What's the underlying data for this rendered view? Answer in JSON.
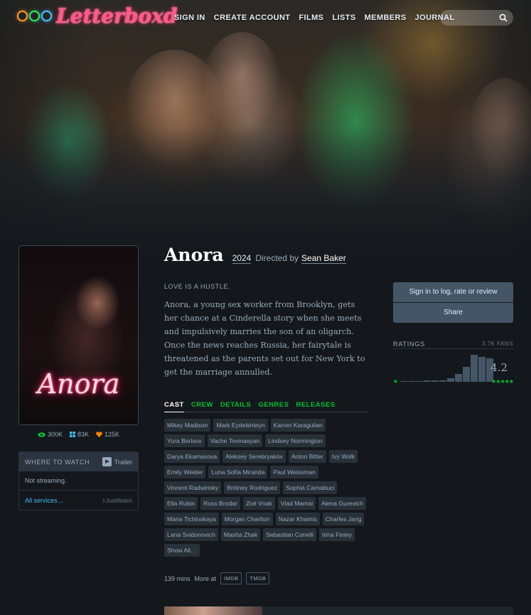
{
  "brand": {
    "name": "Letterboxd"
  },
  "nav": {
    "items": [
      "SIGN IN",
      "CREATE ACCOUNT",
      "FILMS",
      "LISTS",
      "MEMBERS",
      "JOURNAL"
    ],
    "search_placeholder": ""
  },
  "film": {
    "title": "Anora",
    "year": "2024",
    "directed_by_label": "Directed by",
    "director": "Sean Baker",
    "poster_title": "Anora",
    "tagline": "LOVE IS A HUSTLE.",
    "synopsis": "Anora, a young sex worker from Brooklyn, gets her chance at a Cinderella story when she meets and impulsively marries the son of an oligarch. Once the news reaches Russia, her fairytale is threatened as the parents set out for New York to get the marriage annulled.",
    "runtime": "139 mins",
    "more_at_label": "More at",
    "external_links": [
      "IMDB",
      "TMDB"
    ]
  },
  "stats": {
    "watched": "300K",
    "lists": "83K",
    "likes": "125K"
  },
  "where_to_watch": {
    "heading": "WHERE TO WATCH",
    "trailer_label": "Trailer",
    "status": "Not streaming.",
    "all_services": "All services…",
    "provider": "JustWatch"
  },
  "tabs": [
    {
      "label": "CAST",
      "active": true
    },
    {
      "label": "CREW",
      "active": false
    },
    {
      "label": "DETAILS",
      "active": false
    },
    {
      "label": "GENRES",
      "active": false
    },
    {
      "label": "RELEASES",
      "active": false
    }
  ],
  "cast": [
    "Mikey Madison",
    "Mark Eydelshteyn",
    "Karren Karagulian",
    "Yura Borisov",
    "Vache Tovmasyan",
    "Lindsey Normington",
    "Darya Ekamasova",
    "Aleksey Serebryakov",
    "Anton Bitter",
    "Ivy Wolk",
    "Emily Weider",
    "Luna Sofía Miranda",
    "Paul Weissman",
    "Vincent Radwinsky",
    "Brittney Rodriguez",
    "Sophia Carnabuci",
    "Ella Rubin",
    "Ross Brodar",
    "Zoë Vnak",
    "Vlad Mamai",
    "Alena Gurevich",
    "Maria Tichinskaya",
    "Morgan Charlton",
    "Nazar Khamis",
    "Charles Jang",
    "Lana Svidonovich",
    "Masha Zhak",
    "Sebastian Conelli",
    "Irina Finley",
    "Show All…"
  ],
  "actions": {
    "sign_in": "Sign in to log, rate or review",
    "share": "Share"
  },
  "ratings": {
    "label": "RATINGS",
    "fans": "3.7K FANS",
    "average": "4.2",
    "min_star": "★",
    "max_stars": "★★★★★",
    "histogram": [
      0.02,
      0.03,
      0.03,
      0.04,
      0.05,
      0.06,
      0.12,
      0.3,
      0.55,
      1.0,
      0.93,
      0.88
    ]
  },
  "colors": {
    "bg": "#14181c",
    "accent_green": "#00c030",
    "accent_blue": "#40bcf4",
    "accent_orange": "#ff8000",
    "chip_bg": "#283038",
    "action_bg": "#445566"
  }
}
